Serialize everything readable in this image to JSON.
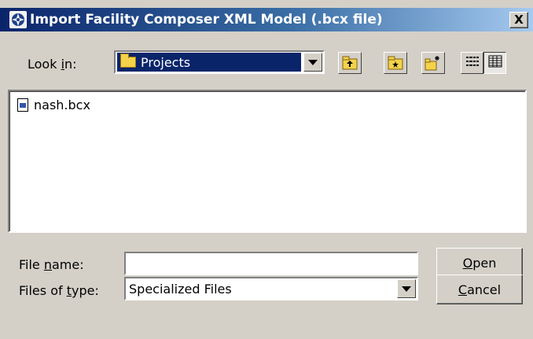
{
  "window": {
    "title": "Import Facility Composer XML Model (.bcx file)",
    "close_label": "X"
  },
  "lookin": {
    "label_pre": "Look ",
    "label_mnemonic": "i",
    "label_post": "n:",
    "selected": "Projects"
  },
  "toolbar": {
    "icons": [
      "folder-up-icon",
      "desktop-folder-icon",
      "new-folder-icon",
      "list-view-icon",
      "details-view-icon"
    ]
  },
  "file_list": {
    "items": [
      "nash.bcx"
    ]
  },
  "filename": {
    "label_pre": "File ",
    "label_mnemonic": "n",
    "label_post": "ame:",
    "value": ""
  },
  "filetype": {
    "label_pre": "Files of ",
    "label_mnemonic": "t",
    "label_post": "ype:",
    "selected": "Specialized Files"
  },
  "buttons": {
    "open_mnemonic": "O",
    "open_rest": "pen",
    "cancel_mnemonic": "C",
    "cancel_rest": "ancel"
  },
  "colors": {
    "title_start": "#0a246a",
    "title_end": "#a6caf0",
    "dialog_bg": "#d4d0c8",
    "selection": "#0a246a"
  }
}
